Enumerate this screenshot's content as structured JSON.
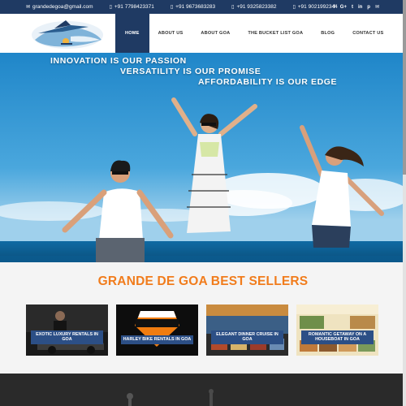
{
  "topbar": {
    "email": "grandedegoa@gmail.com",
    "phones": [
      "+91 7798423371",
      "+91 9673683283",
      "+91 9325823382",
      "+91 9021992344"
    ],
    "social": [
      "f",
      "G+",
      "t",
      "in",
      "p",
      "✉"
    ]
  },
  "nav": {
    "items": [
      "HOME",
      "ABOUT US",
      "ABOUT GOA",
      "THE BUCKET LIST GOA",
      "BLOG",
      "CONTACT US"
    ],
    "active": "HOME"
  },
  "hero": {
    "line1": "INNOVATION IS OUR PASSION",
    "line2": "VERSATILITY IS OUR PROMISE",
    "line3": "AFFORDABILITY IS OUR EDGE"
  },
  "bestsellers": {
    "title": "GRANDE DE GOA BEST SELLERS",
    "cards": [
      {
        "label": "EXOTIC LUXURY RENTALS IN GOA"
      },
      {
        "label": "HARLEY BIKE RENTALS IN GOA"
      },
      {
        "label": "ELEGANT DINNER CRUISE IN GOA"
      },
      {
        "label": "ROMANTIC GETAWAY ON A HOUSEBOAT IN GOA"
      }
    ]
  },
  "icons": {
    "email": "envelope-icon",
    "phone": "phone-icon"
  },
  "colors": {
    "navy": "#1f3a63",
    "orange": "#f17c1c",
    "card_label": "#2c4f86"
  }
}
